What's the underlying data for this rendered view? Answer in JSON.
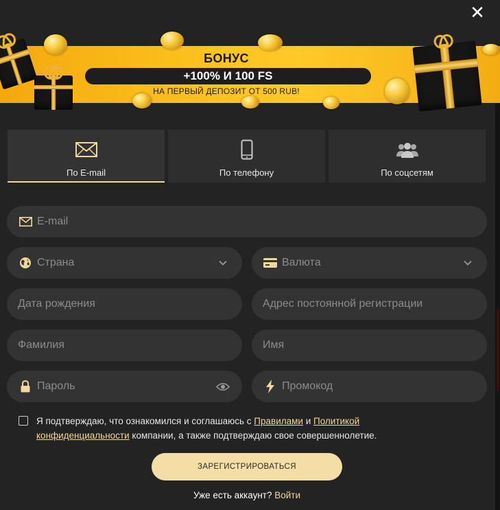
{
  "banner": {
    "title": "БОНУС",
    "offer": "+100% И 100 FS",
    "subtitle": "НА ПЕРВЫЙ ДЕПОЗИТ ОТ 500 RUB!"
  },
  "close_icon": "close-icon",
  "tabs": [
    {
      "label": "По E-mail",
      "icon": "envelope-icon",
      "active": true
    },
    {
      "label": "По телефону",
      "icon": "phone-icon",
      "active": false
    },
    {
      "label": "По соцсетям",
      "icon": "users-icon",
      "active": false
    }
  ],
  "form": {
    "email": {
      "placeholder": "E-mail",
      "icon": "envelope-icon"
    },
    "country": {
      "placeholder": "Страна",
      "icon": "globe-icon"
    },
    "currency": {
      "placeholder": "Валюта",
      "icon": "card-icon"
    },
    "birthdate": {
      "placeholder": "Дата рождения"
    },
    "address": {
      "placeholder": "Адрес постоянной регистрации"
    },
    "last_name": {
      "placeholder": "Фамилия"
    },
    "first_name": {
      "placeholder": "Имя"
    },
    "password": {
      "placeholder": "Пароль",
      "icon": "lock-icon"
    },
    "promo": {
      "placeholder": "Промокод",
      "icon": "lightning-icon"
    }
  },
  "consent": {
    "prefix": "Я подтверждаю, что ознакомился и соглашаюсь с ",
    "rules_link": "Правилами",
    "and": " и ",
    "policy_link_1": "Политикой",
    "space": " ",
    "policy_link_2": "конфиденциальности",
    "suffix": " компании, а также подтверждаю свое совершеннолетие."
  },
  "register_label": "ЗАРЕГИСТРИРОВАТЬСЯ",
  "login": {
    "question": "Уже есть аккаунт?",
    "link": "Войти"
  },
  "colors": {
    "accent": "#f0d79b",
    "background": "#232323",
    "field": "#333333",
    "banner": "#fbbf1c"
  }
}
